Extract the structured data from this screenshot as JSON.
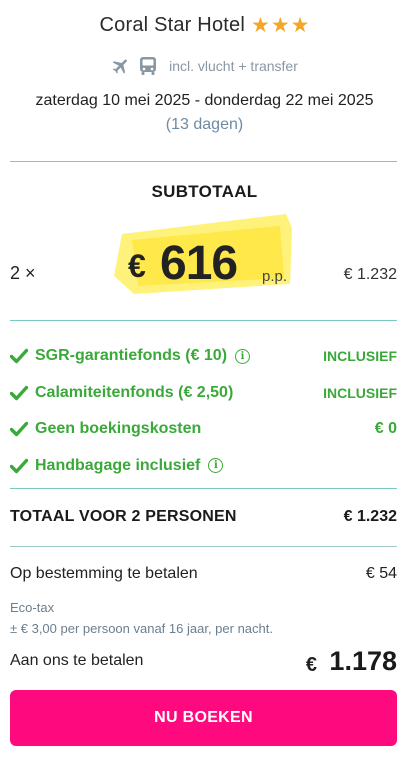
{
  "hotel": {
    "name": "Coral Star Hotel",
    "stars": 3,
    "star_glyph": "★",
    "star_color": "#f5a623"
  },
  "transport": {
    "icons": [
      "airplane-icon",
      "bus-icon"
    ],
    "text": "incl. vlucht + transfer"
  },
  "travel": {
    "dates": "zaterdag 10 mei 2025 - donderdag 22 mei 2025",
    "duration": "(13 dagen)"
  },
  "subtotal": {
    "title": "SUBTOTAAL",
    "quantity": "2 ×",
    "currency": "€",
    "price_per_person": "616",
    "per_person_label": "p.p.",
    "total": "€ 1.232",
    "highlight_color": "#ffe84a"
  },
  "included": [
    {
      "label": "SGR-garantiefonds  (€ 10)",
      "info": true,
      "value": "INCLUSIEF"
    },
    {
      "label": "Calamiteitenfonds  (€ 2,50)",
      "info": false,
      "value": "INCLUSIEF"
    },
    {
      "label": "Geen boekingskosten",
      "info": false,
      "value": "€ 0"
    },
    {
      "label": "Handbagage inclusief",
      "info": true,
      "value": ""
    }
  ],
  "info_glyph": "i",
  "accent_green": "#3aa93a",
  "totals": {
    "label": "TOTAAL VOOR 2 PERSONEN",
    "value": "€ 1.232"
  },
  "destination": {
    "label": "Op bestemming te betalen",
    "value": "€ 54",
    "ecotax_label": "Eco-tax",
    "ecotax_detail": "± € 3,00 per persoon vanaf 16 jaar, per nacht."
  },
  "payment": {
    "label": "Aan ons te betalen",
    "currency": "€",
    "amount": "1.178"
  },
  "book_button": {
    "label": "NU BOEKEN",
    "color": "#ff0a7e"
  }
}
